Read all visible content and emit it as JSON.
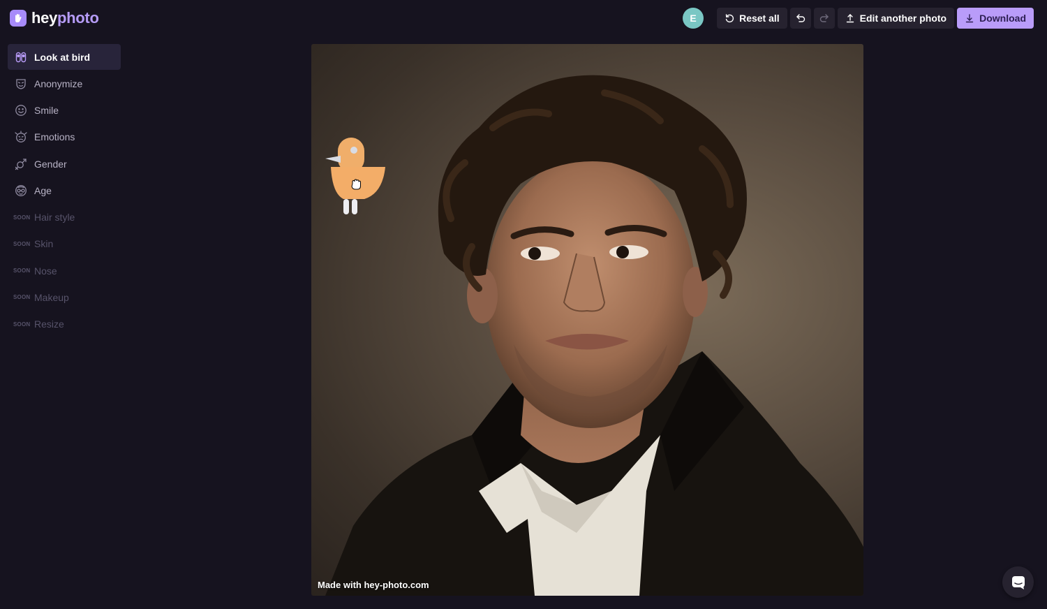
{
  "brand": {
    "part1": "hey",
    "part2": "photo",
    "logo_icon": "hand-wave-icon",
    "accent": "#b99cf9"
  },
  "header": {
    "avatar_initial": "E",
    "reset_label": "Reset all",
    "undo_icon": "undo-icon",
    "redo_icon": "redo-icon",
    "edit_label": "Edit another photo",
    "download_label": "Download"
  },
  "sidebar": {
    "items": [
      {
        "label": "Look at bird",
        "icon": "bird-eyes-icon",
        "state": "active"
      },
      {
        "label": "Anonymize",
        "icon": "mask-icon",
        "state": "normal"
      },
      {
        "label": "Smile",
        "icon": "smile-icon",
        "state": "normal"
      },
      {
        "label": "Emotions",
        "icon": "emotions-icon",
        "state": "normal"
      },
      {
        "label": "Gender",
        "icon": "gender-icon",
        "state": "normal"
      },
      {
        "label": "Age",
        "icon": "age-icon",
        "state": "normal"
      },
      {
        "label": "Hair style",
        "soon": "SOON",
        "state": "disabled"
      },
      {
        "label": "Skin",
        "soon": "SOON",
        "state": "disabled"
      },
      {
        "label": "Nose",
        "soon": "SOON",
        "state": "disabled"
      },
      {
        "label": "Makeup",
        "soon": "SOON",
        "state": "disabled"
      },
      {
        "label": "Resize",
        "soon": "SOON",
        "state": "disabled"
      }
    ]
  },
  "photo": {
    "watermark": "Made with hey-photo.com",
    "overlay": "bird-sticker",
    "cursor": "grab-hand-cursor"
  },
  "chat": {
    "icon": "chat-icon"
  }
}
